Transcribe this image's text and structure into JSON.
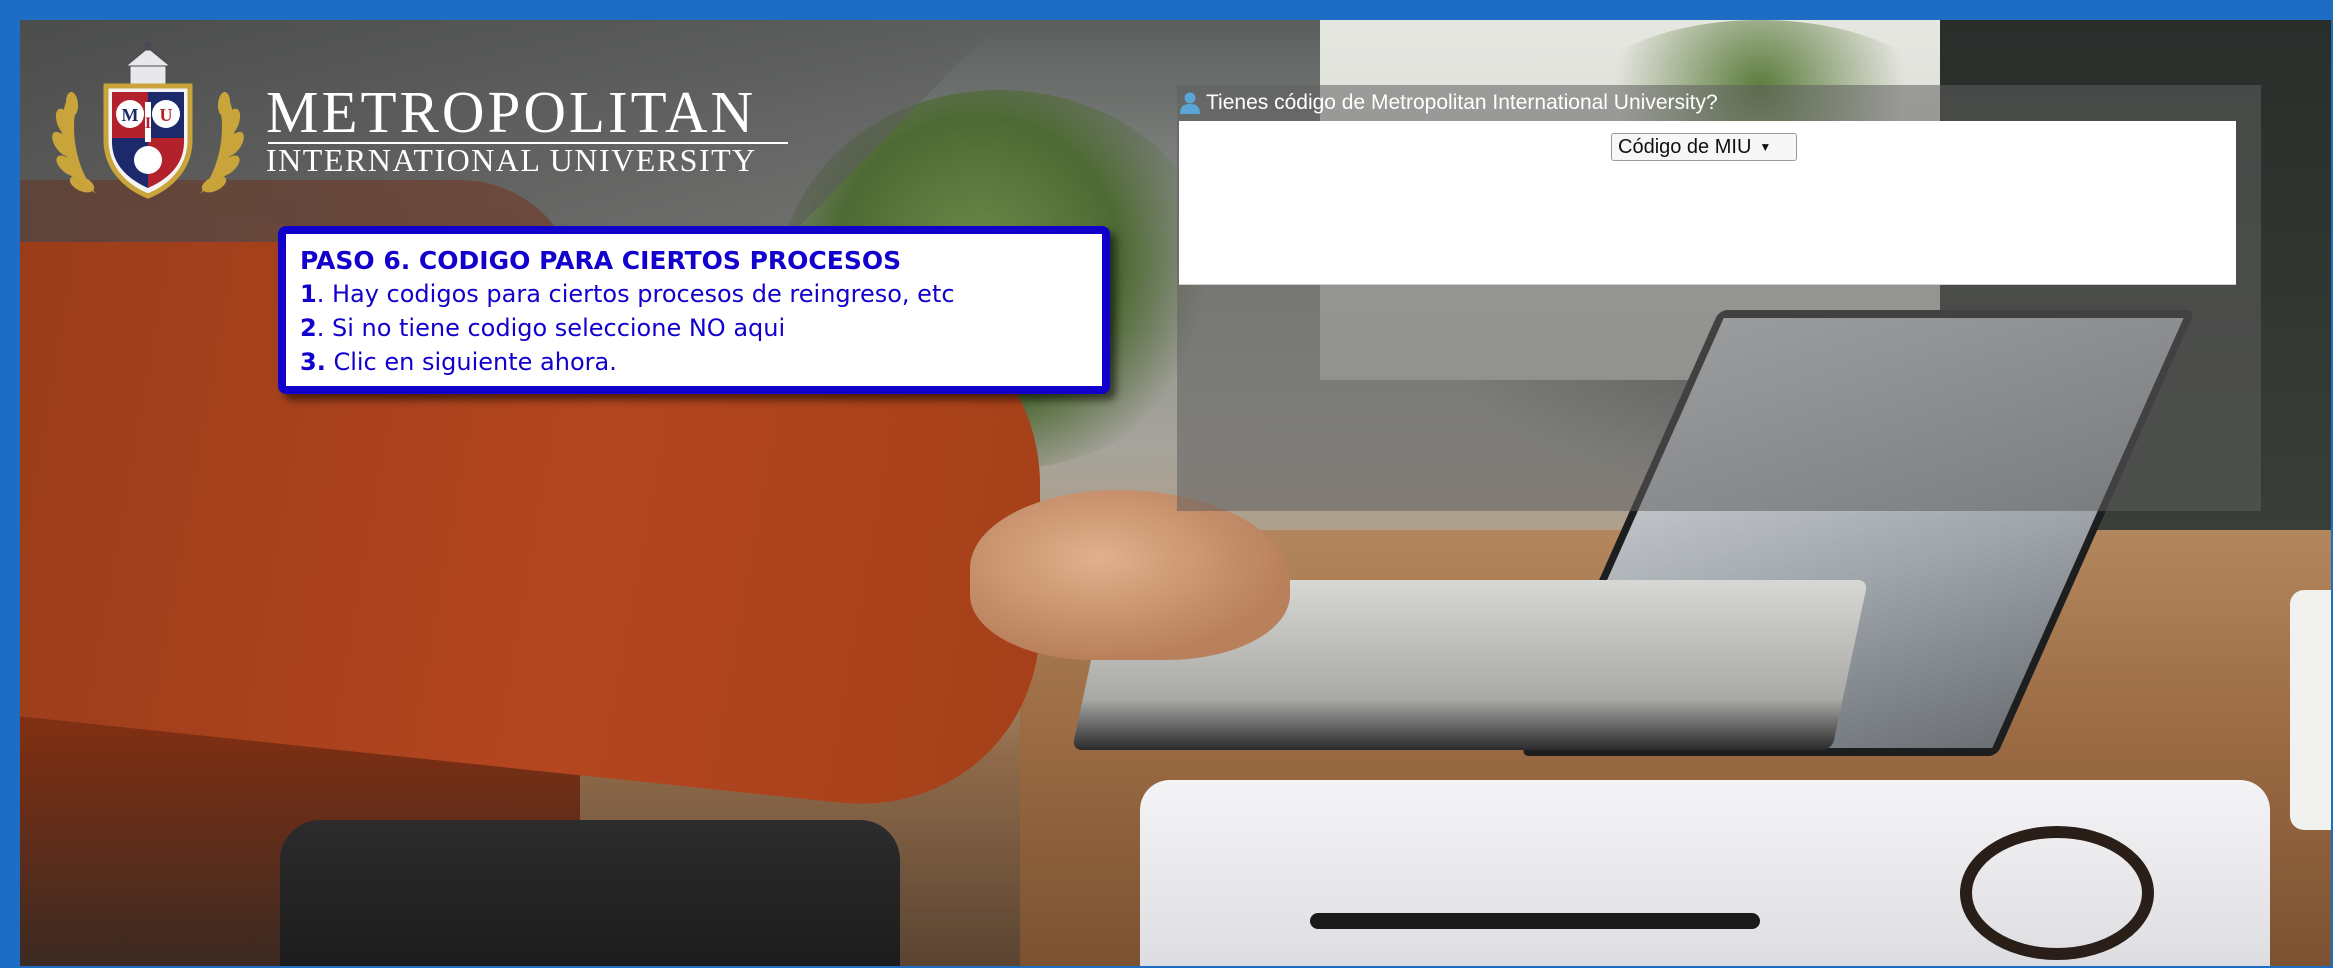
{
  "brand": {
    "logo_letters": [
      "M",
      "I",
      "U"
    ],
    "title": "METROPOLITAN",
    "subtitle": "INTERNATIONAL UNIVERSITY"
  },
  "instructions": {
    "title": "PASO 6. CODIGO PARA CIERTOS PROCESOS",
    "items": [
      {
        "num": "1",
        "text": ". Hay codigos para ciertos procesos de reingreso, etc"
      },
      {
        "num": "2",
        "text": ". Si no tiene codigo seleccione NO aqui"
      },
      {
        "num": "3.",
        "text": " Clic en siguiente ahora."
      }
    ]
  },
  "form": {
    "question": "Tienes código de Metropolitan International University?",
    "icon": "user-icon",
    "select_value": "Código de MIU"
  },
  "colors": {
    "frame": "#1d6dc4",
    "instruction_text": "#1200cc",
    "instruction_border": "#1100cc",
    "user_icon": "#5aa6d6",
    "crest_gold": "#c9a43a",
    "crest_red": "#b3222c",
    "crest_navy": "#1c2a6b"
  }
}
